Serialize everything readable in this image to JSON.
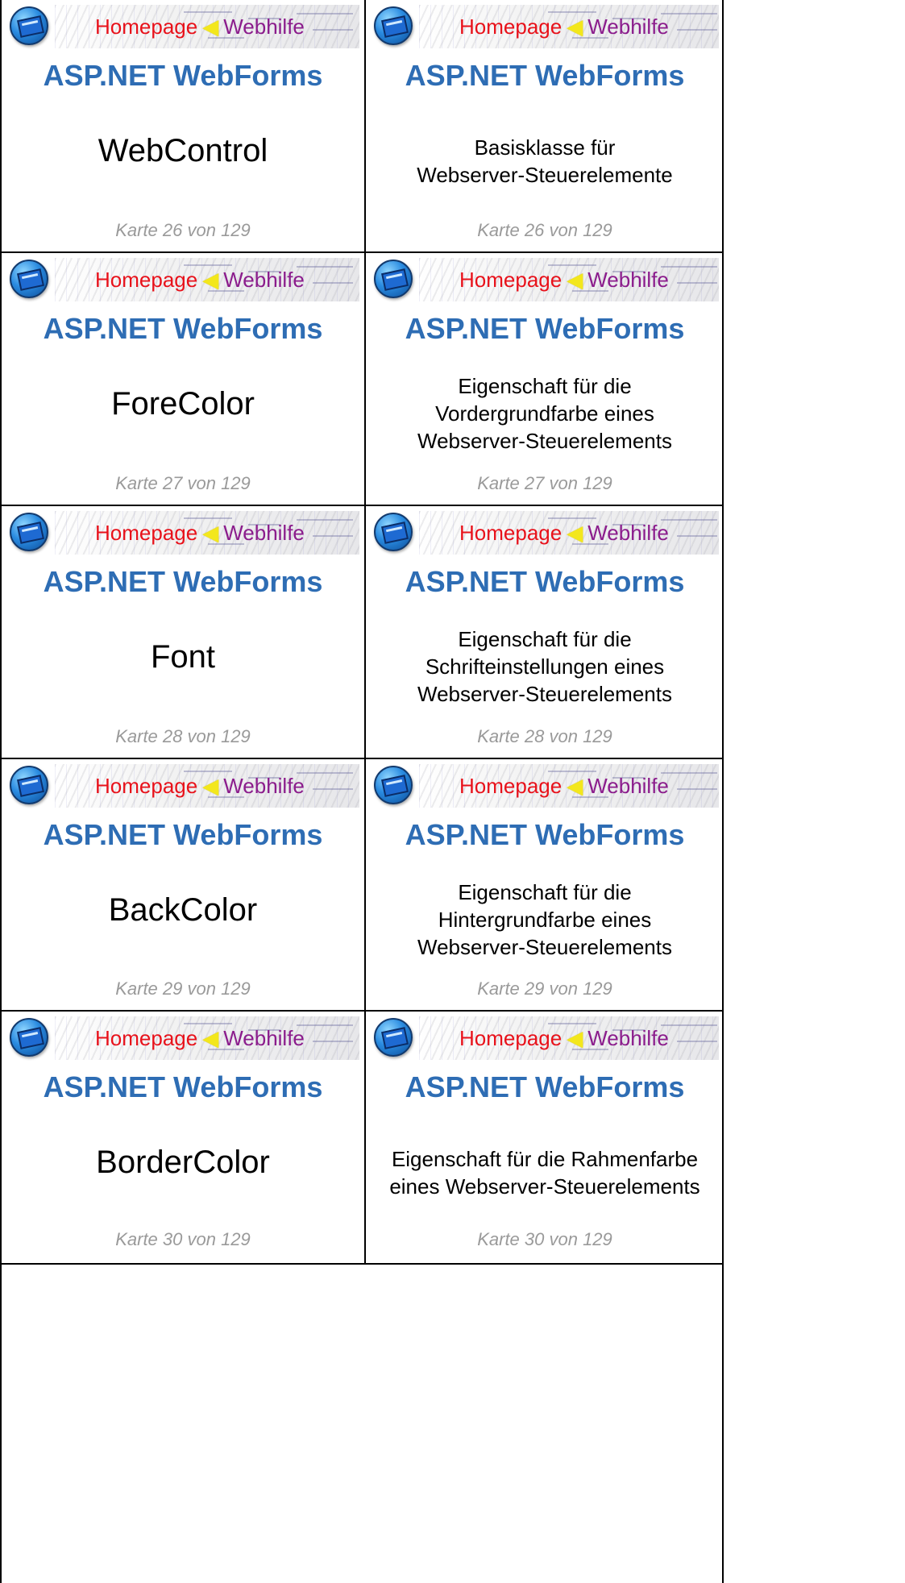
{
  "header": {
    "brand_home": "Homepage",
    "brand_help": "Webhilfe",
    "title": "ASP.NET WebForms"
  },
  "cards": [
    {
      "term": "WebControl",
      "definition_lines": [
        "Basisklasse für",
        "Webserver-Steuerelemente"
      ],
      "counter": "Karte 26 von 129"
    },
    {
      "term": "ForeColor",
      "definition_lines": [
        "Eigenschaft für die",
        "Vordergrundfarbe eines",
        "Webserver-Steuerelements"
      ],
      "counter": "Karte 27 von 129"
    },
    {
      "term": "Font",
      "definition_lines": [
        "Eigenschaft für die",
        "Schrifteinstellungen eines",
        "Webserver-Steuerelements"
      ],
      "counter": "Karte 28 von 129"
    },
    {
      "term": "BackColor",
      "definition_lines": [
        "Eigenschaft für die",
        "Hintergrundfarbe eines",
        "Webserver-Steuerelements"
      ],
      "counter": "Karte 29 von 129"
    },
    {
      "term": "BorderColor",
      "definition_lines": [
        "Eigenschaft für die Rahmenfarbe",
        "eines Webserver-Steuerelements"
      ],
      "counter": "Karte 30 von 129"
    }
  ],
  "colors": {
    "title": "#2e6db4",
    "homepage": "#e8121b",
    "webhilfe": "#8b1c8c",
    "counter": "#9a9a9a"
  },
  "icons": {
    "logo": "homepage-webhilfe-logo-icon",
    "arrow": "yellow-arrow-icon"
  }
}
